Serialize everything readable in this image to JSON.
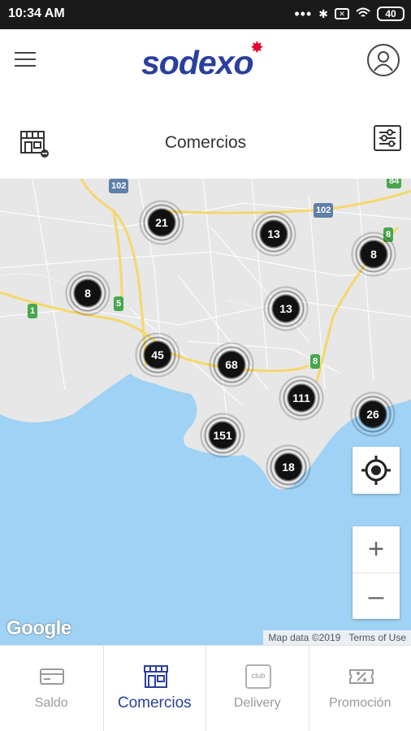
{
  "status_bar": {
    "time": "10:34 AM",
    "dots": "•••",
    "battery": "40"
  },
  "app": {
    "logo_text": "sodexo",
    "menu_icon": "hamburger-icon",
    "profile_icon": "user-profile-icon"
  },
  "section": {
    "title": "Comercios",
    "left_icon": "store-add-icon",
    "right_icon": "filter-sliders-icon"
  },
  "map": {
    "clusters": [
      "21",
      "13",
      "8",
      "8",
      "13",
      "45",
      "68",
      "111",
      "26",
      "151",
      "18"
    ],
    "road_shields": [
      "102",
      "102",
      "84",
      "8",
      "5",
      "1",
      "8"
    ],
    "zoom_in": "+",
    "zoom_out": "–",
    "google_logo": "Google",
    "map_data": "Map data ©2019",
    "terms": "Terms of Use"
  },
  "bottom_nav": {
    "items": [
      {
        "label": "Saldo",
        "icon": "card-icon",
        "active": false
      },
      {
        "label": "Comercios",
        "icon": "store-icon",
        "active": true
      },
      {
        "label": "Delivery",
        "icon": "club-delivery-icon",
        "active": false
      },
      {
        "label": "Promoción",
        "icon": "discount-ticket-icon",
        "active": false
      }
    ]
  },
  "colors": {
    "brand_blue": "#2a3f9d",
    "brand_red": "#e4002b",
    "water": "#9fd2f5",
    "land": "#e7e7e7",
    "road_yellow": "#f5d76b"
  }
}
